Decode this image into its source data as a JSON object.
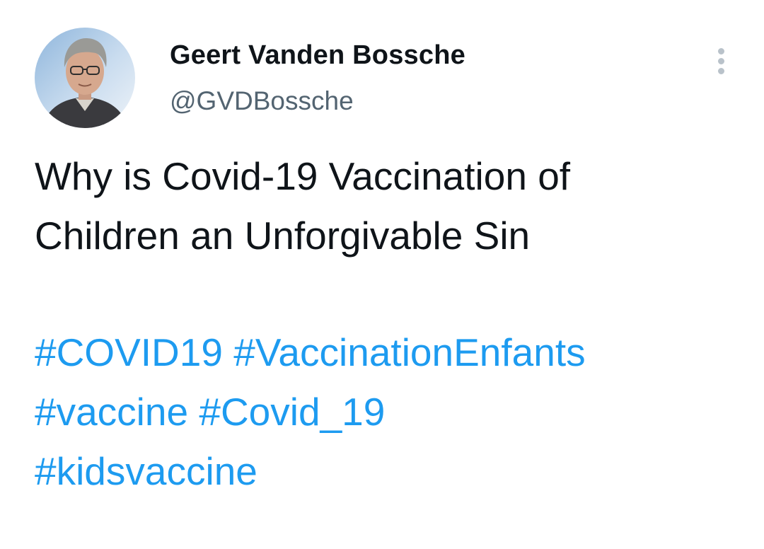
{
  "author": {
    "display_name": "Geert Vanden Bossche",
    "handle": "@GVDBossche"
  },
  "tweet": {
    "text_lines": [
      "Why is Covid-19 Vaccination of",
      "Children an Unforgivable Sin"
    ],
    "hashtags": [
      "#COVID19",
      "#VaccinationEnfants",
      "#vaccine",
      "#Covid_19",
      "#kidsvaccine"
    ]
  },
  "icons": {
    "more": "more-vertical-icon"
  },
  "colors": {
    "text": "#0f1419",
    "secondary_text": "#536471",
    "link": "#1d9bf0"
  }
}
